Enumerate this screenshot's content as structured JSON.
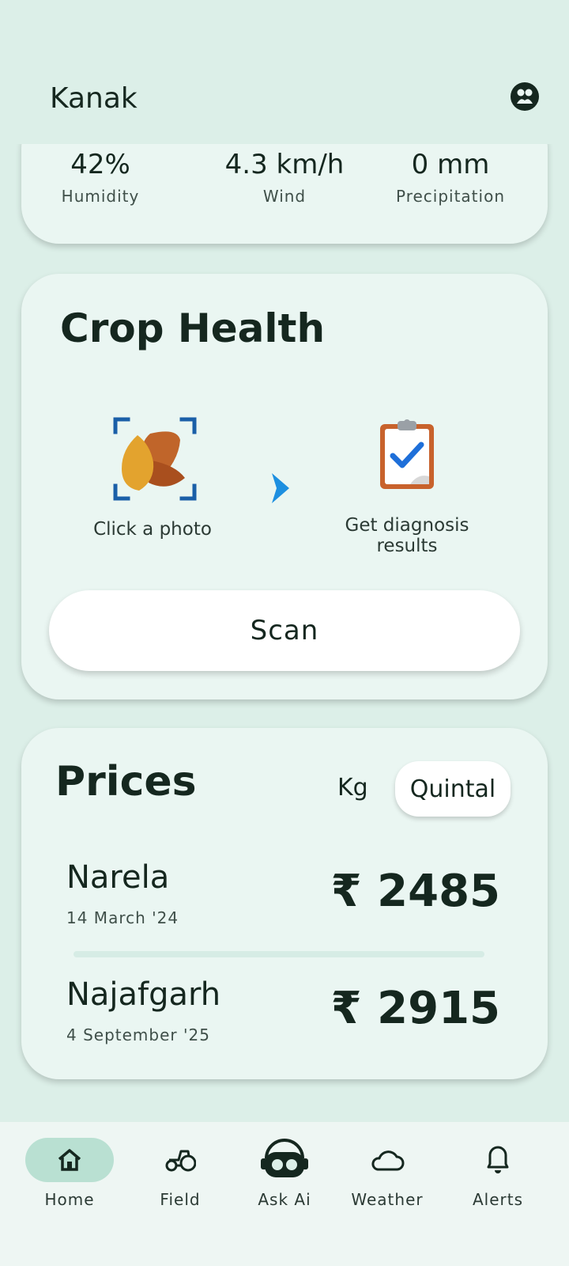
{
  "header": {
    "title": "Kanak"
  },
  "weather": {
    "stats": [
      {
        "value": "42%",
        "label": "Humidity"
      },
      {
        "value": "4.3 km/h",
        "label": "Wind"
      },
      {
        "value": "0 mm",
        "label": "Precipitation"
      }
    ]
  },
  "crop_health": {
    "title": "Crop Health",
    "step1_label": "Click a photo",
    "step2_label": "Get diagnosis results",
    "scan_label": "Scan"
  },
  "prices": {
    "title": "Prices",
    "unit_kg": "Kg",
    "unit_quintal": "Quintal",
    "selected_unit": "Quintal",
    "markets": [
      {
        "name": "Narela",
        "date": "14 March '24",
        "price": "₹ 2485"
      },
      {
        "name": "Najafgarh",
        "date": "4 September '25",
        "price": "₹ 2915"
      }
    ]
  },
  "nav": {
    "items": [
      {
        "label": "Home",
        "icon": "home-icon"
      },
      {
        "label": "Field",
        "icon": "tractor-icon"
      },
      {
        "label": "Ask Ai",
        "icon": "robot-icon"
      },
      {
        "label": "Weather",
        "icon": "cloud-icon"
      },
      {
        "label": "Alerts",
        "icon": "bell-icon"
      }
    ]
  },
  "colors": {
    "background": "#dcefe8",
    "card": "#eaf6f2",
    "text": "#15271f",
    "nav_active": "#b9e0d2",
    "check_blue": "#1e6fd9"
  }
}
